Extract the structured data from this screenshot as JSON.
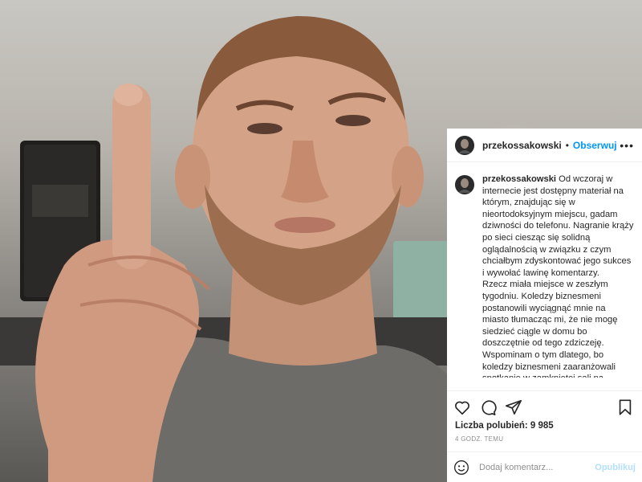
{
  "post": {
    "image_description": "man with beard raising index finger",
    "header": {
      "username": "przekossakowski",
      "separator": "•",
      "follow_label": "Obserwuj",
      "more_icon": "more-options-icon"
    },
    "caption": {
      "username": "przekossakowski",
      "paragraph_1": " Od wczoraj w internecie jest dostępny materiał na którym, znajdując się w nieortodoksyjnym miejscu, gadam dziwności do telefonu. Nagranie krąży po sieci ciesząc się solidną oglądalnością w związku z czym chciałbym zdyskontować jego sukces i wywołać lawinę komentarzy.",
      "paragraph_2": "Rzecz miała miejsce w zeszłym tygodniu. Koledzy biznesmeni postanowili wyciągnąć mnie na miasto tłumacząc mi, że nie mogę siedzieć ciągle w domu bo doszczętnie od tego zdziczeję. Wspominam o tym dlatego, bo koledzy biznesmeni zaaranżowali spotkanie w zamkniętej sali na zapleczu jednej z restauracji dowodząc rzeczowo, że jeżeli będziemy pili alkohol w przestrzeni publicznej, ktoś"
    },
    "actions": {
      "like_icon": "heart-icon",
      "comment_icon": "comment-icon",
      "share_icon": "share-icon",
      "save_icon": "bookmark-icon"
    },
    "likes_text": "Liczba polubień: 9 985",
    "time_text": "4 GODZ. TEMU",
    "comment": {
      "emoji_icon": "emoji-icon",
      "placeholder": "Dodaj komentarz...",
      "value": "",
      "publish_label": "Opublikuj"
    }
  },
  "colors": {
    "link": "#0095f6",
    "publish_disabled": "#b2dffc",
    "text": "#262626",
    "muted": "#8e8e8e"
  }
}
